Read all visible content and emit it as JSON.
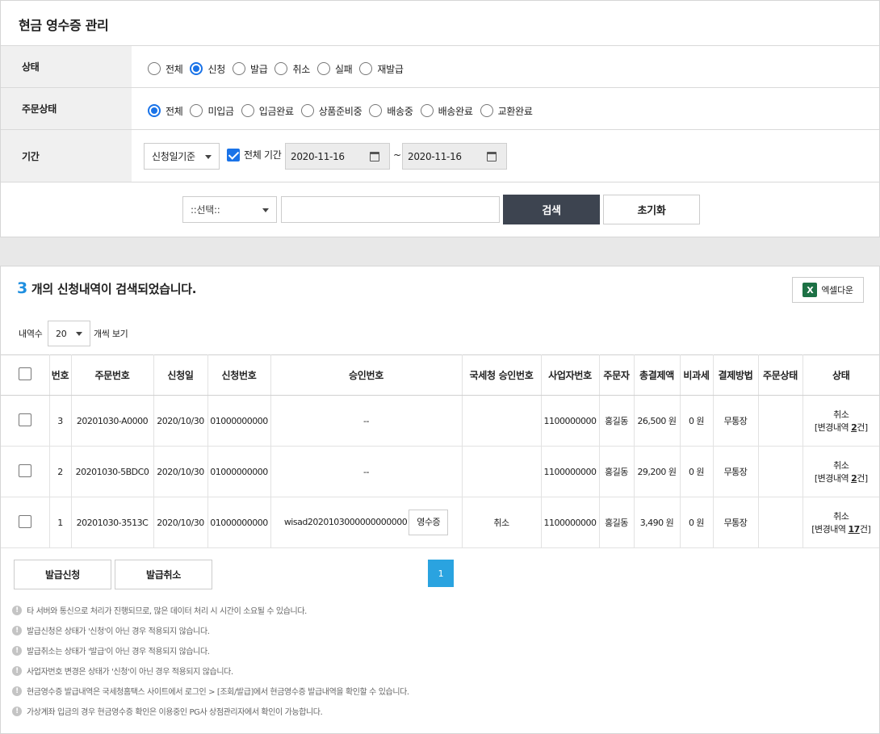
{
  "title": "현금 영수증 관리",
  "filters": {
    "status_label": "상태",
    "status_options": [
      "전체",
      "신청",
      "발급",
      "취소",
      "실패",
      "재발급"
    ],
    "status_selected": "신청",
    "order_status_label": "주문상태",
    "order_status_options": [
      "전체",
      "미입금",
      "입금완료",
      "상품준비중",
      "배송중",
      "배송완료",
      "교환완료"
    ],
    "order_status_selected": "전체",
    "period_label": "기간",
    "period_basis": "신청일기준",
    "all_period_label": "전체 기간",
    "all_period_checked": true,
    "date_from": "2020-11-16",
    "date_tilde": "~",
    "date_to": "2020-11-16",
    "keyword_select": "::선택::",
    "keyword_value": "",
    "search_button": "검색",
    "reset_button": "초기화"
  },
  "results": {
    "count": "3",
    "count_suffix": "개의 신청내역이 검색되었습니다.",
    "excel_button": "엑셀다운",
    "rows_label": "내역수",
    "rows_per_page": "20",
    "rows_suffix": "개씩 보기",
    "columns": [
      "번호",
      "주문번호",
      "신청일",
      "신청번호",
      "승인번호",
      "국세청 승인번호",
      "사업자번호",
      "주문자",
      "총결제액",
      "비과세",
      "결제방법",
      "주문상태",
      "상태"
    ],
    "rows": [
      {
        "no": "3",
        "order_no": "20201030-A0000",
        "date": "2020/10/30",
        "req_no": "01000000000",
        "approval": "--",
        "approval_btn": "",
        "nts": "",
        "biz_no": "1100000000",
        "buyer": "홍길동",
        "total": "26,500 원",
        "taxfree": "0 원",
        "method": "무통장",
        "order_status": "",
        "status": "취소",
        "history_pre": "[변경내역 ",
        "history_num": "2",
        "history_post": "건]"
      },
      {
        "no": "2",
        "order_no": "20201030-5BDC0",
        "date": "2020/10/30",
        "req_no": "01000000000",
        "approval": "--",
        "approval_btn": "",
        "nts": "",
        "biz_no": "1100000000",
        "buyer": "홍길동",
        "total": "29,200 원",
        "taxfree": "0 원",
        "method": "무통장",
        "order_status": "",
        "status": "취소",
        "history_pre": "[변경내역 ",
        "history_num": "2",
        "history_post": "건]"
      },
      {
        "no": "1",
        "order_no": "20201030-3513C",
        "date": "2020/10/30",
        "req_no": "01000000000",
        "approval": "wisad2020103000000000000",
        "approval_btn": "영수증",
        "nts": "취소",
        "biz_no": "1100000000",
        "buyer": "홍길동",
        "total": "3,490 원",
        "taxfree": "0 원",
        "method": "무통장",
        "order_status": "",
        "status": "취소",
        "history_pre": "[변경내역 ",
        "history_num": "17",
        "history_post": "건]"
      }
    ],
    "issue_button": "발급신청",
    "cancel_button": "발급취소",
    "page": "1"
  },
  "notes": [
    "타 서버와 통신으로 처리가 진행되므로, 많은 데이터 처리 시 시간이 소요될 수 있습니다.",
    "발급신청은 상태가 '신청'이 아닌 경우 적용되지 않습니다.",
    "발급취소는 상태가 '발급'이 아닌 경우 적용되지 않습니다.",
    "사업자번호 변경은 상태가 '신청'이 아닌 경우 적용되지 않습니다.",
    "현금영수증 발급내역은 국세청홈택스 사이트에서 로그인 > [조회/발급]에서 현금영수증 발급내역을 확인할 수 있습니다.",
    "가상계좌 입금의 경우 현금영수증 확인은 이용중인 PG사 상점관리자에서 확인이 가능합니다."
  ],
  "colors": {
    "accent": "#1a73e8",
    "search_btn": "#3d4450",
    "page_active": "#2aa3e0",
    "count": "#1f8fe0"
  },
  "icons": {
    "excel": "excel-icon",
    "calendar": "calendar-icon",
    "notice": "info-icon"
  }
}
